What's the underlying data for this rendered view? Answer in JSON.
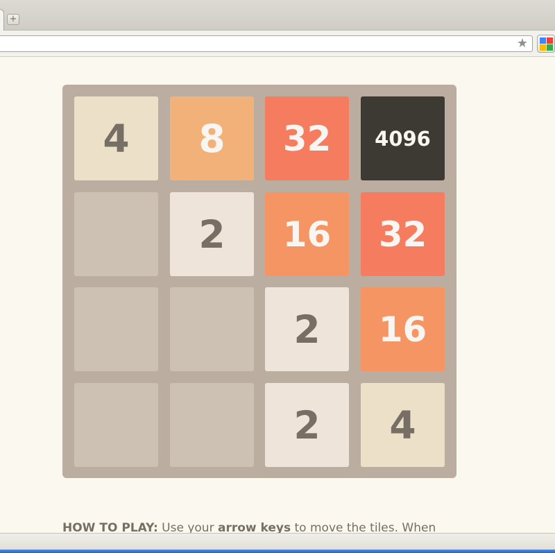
{
  "browser": {
    "new_tab_glyph": "+",
    "star_glyph": "★",
    "extension_colors": [
      "#4285f4",
      "#ea4335",
      "#fbbc05",
      "#34a853"
    ]
  },
  "game": {
    "grid_size": 4,
    "tiles": [
      {
        "row": 0,
        "col": 0,
        "value": 4
      },
      {
        "row": 0,
        "col": 1,
        "value": 8
      },
      {
        "row": 0,
        "col": 2,
        "value": 32
      },
      {
        "row": 0,
        "col": 3,
        "value": 4096
      },
      {
        "row": 1,
        "col": 1,
        "value": 2
      },
      {
        "row": 1,
        "col": 2,
        "value": 16
      },
      {
        "row": 1,
        "col": 3,
        "value": 32
      },
      {
        "row": 2,
        "col": 2,
        "value": 2
      },
      {
        "row": 2,
        "col": 3,
        "value": 16
      },
      {
        "row": 3,
        "col": 2,
        "value": 2
      },
      {
        "row": 3,
        "col": 3,
        "value": 4
      }
    ],
    "colors": {
      "board": "#bbada0",
      "empty_cell": "#cdc1b4",
      "tile_2": "#eee4da",
      "tile_4": "#ede0c8",
      "tile_8": "#f2b179",
      "tile_16": "#f59563",
      "tile_32": "#f67c5f",
      "tile_super": "#3c3a32",
      "dark_text": "#776e65",
      "light_text": "#f9f6f2"
    }
  },
  "instructions": {
    "heading": "HOW TO PLAY:",
    "text_1": " Use your ",
    "emphasis": "arrow keys",
    "text_2": " to move the tiles. When"
  }
}
